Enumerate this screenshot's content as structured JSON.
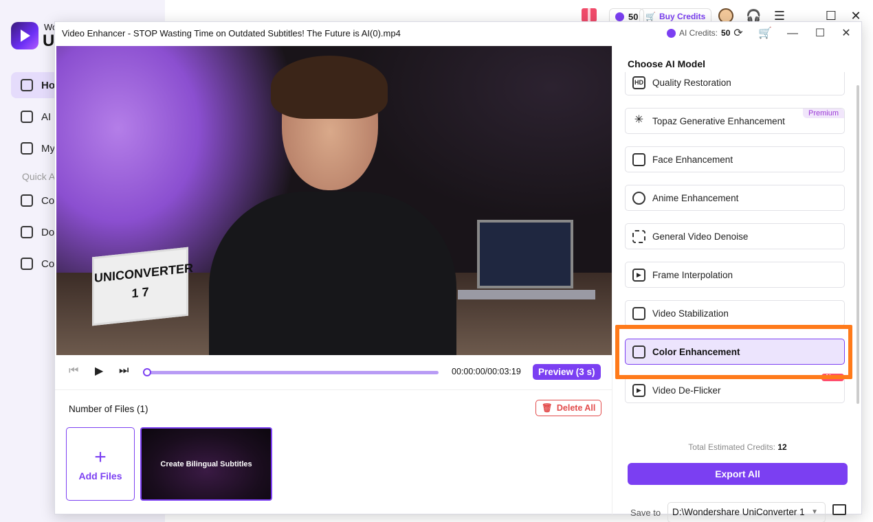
{
  "background_app": {
    "brand_line1": "Wo",
    "brand_line2": "U",
    "nav_items": [
      {
        "label": "Ho",
        "icon": "home-icon",
        "active": true
      },
      {
        "label": "AI",
        "icon": "ai-tools-icon",
        "active": false
      },
      {
        "label": "My",
        "icon": "my-files-icon",
        "active": false
      }
    ],
    "section_label": "Quick A",
    "quick_items": [
      {
        "label": "Co",
        "icon": "converter-icon"
      },
      {
        "label": "Do",
        "icon": "downloader-icon"
      },
      {
        "label": "Co",
        "icon": "compressor-icon"
      }
    ],
    "top_credits": "50",
    "buy_credits_label": "Buy Credits"
  },
  "dialog": {
    "title": "Video Enhancer - STOP Wasting Time on Outdated Subtitles! The Future is AI(0).mp4",
    "ai_credits_label": "AI Credits:",
    "ai_credits_value": "50"
  },
  "player": {
    "lightbox_line1": "UNICONVERTER",
    "lightbox_line2": "1 7",
    "timecode": "00:00:00/00:03:19",
    "progress_fraction": 0,
    "preview_label": "Preview (3 s)"
  },
  "files": {
    "title": "Number of Files (1)",
    "delete_all_label": "Delete All",
    "add_files_label": "Add Files",
    "thumb_caption": "Create Bilingual Subtitles"
  },
  "panel": {
    "title": "Choose AI Model",
    "models": [
      {
        "label": "Quality Restoration",
        "icon": "hd-icon",
        "badge": ""
      },
      {
        "label": "Topaz Generative Enhancement",
        "icon": "sparkle-icon",
        "badge": "Premium"
      },
      {
        "label": "Face Enhancement",
        "icon": "face-scan-icon",
        "badge": ""
      },
      {
        "label": "Anime Enhancement",
        "icon": "anime-icon",
        "badge": ""
      },
      {
        "label": "General Video Denoise",
        "icon": "denoise-icon",
        "badge": ""
      },
      {
        "label": "Frame Interpolation",
        "icon": "frame-interpolation-icon",
        "badge": ""
      },
      {
        "label": "Video Stabilization",
        "icon": "stabilization-icon",
        "badge": ""
      },
      {
        "label": "Color Enhancement",
        "icon": "color-enhancement-icon",
        "badge": "",
        "selected": true
      },
      {
        "label": "Video De-Flicker",
        "icon": "deflicker-icon",
        "badge": "New"
      }
    ],
    "estimated_label": "Total Estimated Credits:",
    "estimated_value": "12",
    "export_label": "Export All",
    "save_to_label": "Save to",
    "save_path": "D:\\Wondershare UniConverter 1"
  },
  "colors": {
    "accent": "#7b3ff2",
    "highlight": "#ff7a1a",
    "danger": "#e24b4b"
  }
}
